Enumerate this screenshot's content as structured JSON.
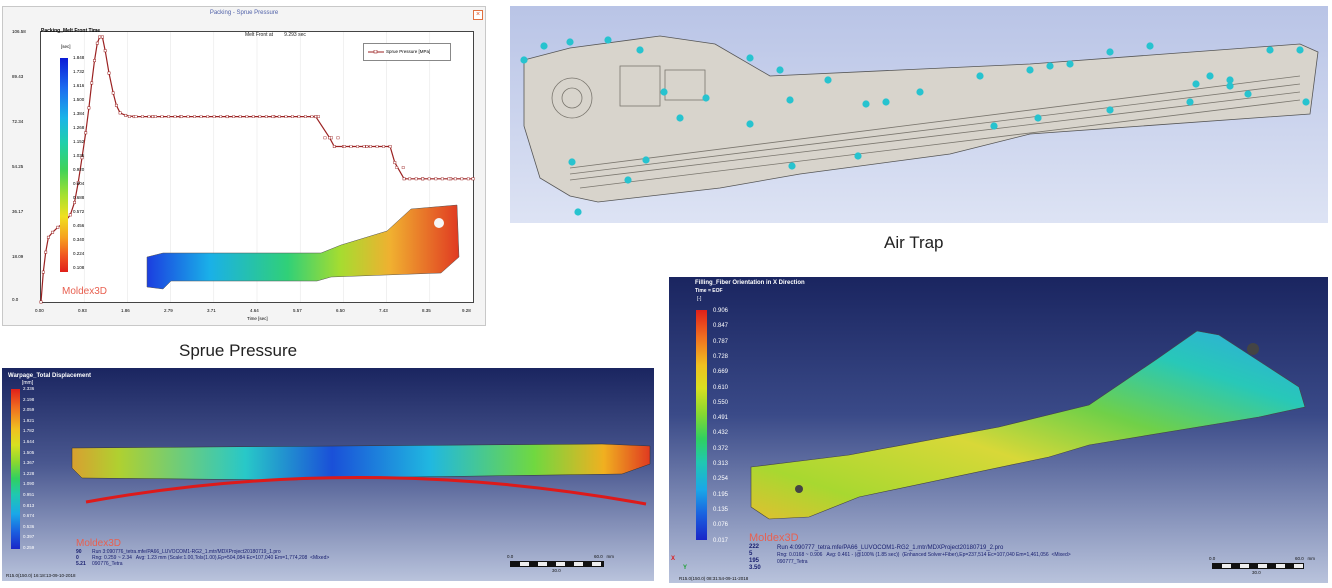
{
  "sprue": {
    "window_title": "Packing - Sprue Pressure",
    "chart_header": "Packing_Melt Front Time",
    "melt_front": "Melt Front at        9.293 sec",
    "unit": "[sec]",
    "legend": "Sprue Pressure [MPa]",
    "xlabel": "Time [sec]",
    "logo": "Moldex3D",
    "caption": "Sprue Pressure",
    "color_scale": [
      "1.848",
      "1.732",
      "1.616",
      "1.500",
      "1.384",
      "1.268",
      "1.152",
      "1.036",
      "0.920",
      "0.804",
      "0.688",
      "0.572",
      "0.456",
      "0.340",
      "0.224",
      "0.108"
    ]
  },
  "chart_data": {
    "type": "line",
    "title": "",
    "xlabel": "Time [sec]",
    "ylabel": "",
    "x_ticks": [
      "0.00",
      "0.93",
      "1.86",
      "2.79",
      "3.71",
      "4.64",
      "5.57",
      "6.50",
      "7.43",
      "8.35",
      "9.28"
    ],
    "y_ticks": [
      "106.58",
      "89.43",
      "72.34",
      "54.25",
      "36.17",
      "18.09",
      "0.0"
    ],
    "xlim": [
      0,
      9.28
    ],
    "ylim": [
      0,
      108.5
    ],
    "series": [
      {
        "name": "Sprue Pressure [MPa]",
        "x": [
          0.0,
          0.05,
          0.1,
          0.16,
          0.25,
          0.36,
          0.5,
          0.63,
          0.72,
          0.8,
          0.88,
          0.96,
          1.03,
          1.09,
          1.15,
          1.21,
          1.26,
          1.32,
          1.38,
          1.46,
          1.55,
          1.62,
          1.7,
          1.82,
          2.0,
          2.4,
          3.0,
          4.0,
          5.0,
          5.9,
          6.2,
          6.3,
          6.5,
          7.0,
          7.5,
          7.6,
          7.8,
          8.2,
          8.8,
          9.28
        ],
        "y": [
          0.0,
          12.0,
          20.0,
          26.0,
          28.0,
          30.0,
          32.0,
          35.0,
          40.0,
          48.0,
          58.0,
          68.0,
          78.0,
          88.0,
          97.0,
          104.0,
          106.5,
          106.5,
          101.0,
          92.0,
          84.0,
          79.0,
          76.0,
          75.0,
          74.5,
          74.5,
          74.5,
          74.5,
          74.5,
          74.5,
          66.0,
          62.5,
          62.5,
          62.5,
          62.5,
          56.0,
          49.5,
          49.5,
          49.5,
          49.5
        ]
      }
    ]
  },
  "air_trap": {
    "caption": "Air Trap"
  },
  "warpage": {
    "title": "Warpage_Total Displacement",
    "unit": "[mm]",
    "color_scale": [
      "2.336",
      "2.198",
      "2.059",
      "1.921",
      "1.782",
      "1.644",
      "1.505",
      "1.367",
      "1.228",
      "1.090",
      "0.951",
      "0.813",
      "0.674",
      "0.536",
      "0.397",
      "0.259"
    ],
    "logo": "Moldex3D",
    "run_line": "Run 3:090776_tetra.mfe/PA66_LUVOCOM1-RG2_1.mtr/MDXProject20180719_1.pro",
    "rng_line": "Rng: 0.259 ~ 2.34   Avg: 1.23 mm (Scale:1.00,Tols(1.00),Ep=504,084 Ec=107,040 Em=1,774,208  <Mixed>",
    "model_line": "090776_Tetra",
    "num1": "90",
    "num2": "0",
    "num3": "5.21",
    "scale_left": "0.0",
    "scale_right": "60.0   mm",
    "scale_mid": "30.0",
    "footer": "R15.0(150.0) 16:18:13-09-10-2018"
  },
  "fiber": {
    "title": "Filling_Fiber Orientation in X Direction",
    "time": "Time = EOF",
    "unit": "[-]",
    "color_scale": [
      "0.906",
      "0.847",
      "0.787",
      "0.728",
      "0.669",
      "0.610",
      "0.550",
      "0.491",
      "0.432",
      "0.372",
      "0.313",
      "0.254",
      "0.195",
      "0.135",
      "0.076",
      "0.017"
    ],
    "logo": "Moldex3D",
    "num1": "222",
    "num2": "5",
    "num3": "195",
    "num4": "3.50",
    "run_line": "Run 4:090777_tetra.mfe/PA66_LUVOCOM1-RG2_1.mtr/MDXProject20180719_2.pro",
    "rng_line": "Rng: 0.0168 ~ 0.906   Avg: 0.461 - (@100% (1.85 sec))  (Enhanced Solver+Fiber),Ep=237,514 Ec=107,040 Em=1,461,056  <Mixed>",
    "model_line": "090777_Tetra",
    "scale_left": "0.0",
    "scale_right": "60.0   mm",
    "scale_mid": "30.0",
    "footer": "R15.0(150.0) 08:31:54-09-11-2018",
    "axis_x": "X",
    "axis_y": "Y"
  },
  "colors": {
    "panel_blue_top": "#1a2560",
    "panel_blue_bottom": "#b9c3dc",
    "grid_line": "#e3e3e3",
    "series_line": "#9b2222",
    "red_accent": "#dd1a1a"
  }
}
